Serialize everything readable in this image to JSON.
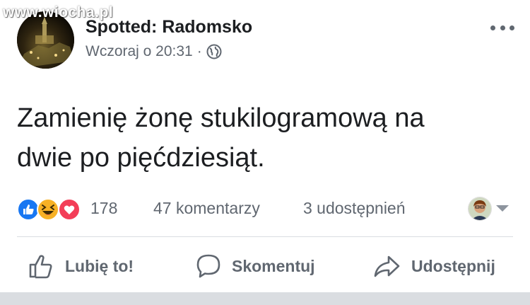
{
  "watermark": {
    "text": "www.wiocha.pl"
  },
  "post": {
    "page_name": "Spotted: Radomsko",
    "timestamp": "Wczoraj o 20:31",
    "separator": "·",
    "privacy_icon": "globe-icon",
    "more_icon": "more-options-icon",
    "text": "Zamienię żonę stukilogramową na\ndwie po pięćdziesiąt."
  },
  "stats": {
    "reactions": [
      "like-reaction-icon",
      "haha-reaction-icon",
      "love-reaction-icon"
    ],
    "reaction_count": "178",
    "comments": "47 komentarzy",
    "shares": "3 udostępnień"
  },
  "actions": {
    "like_label": "Lubię to!",
    "comment_label": "Skomentuj",
    "share_label": "Udostępnij"
  },
  "colors": {
    "like_blue": "#1877f2",
    "haha_yellow": "#f7b125",
    "love_red": "#f33e58",
    "text_secondary": "#606770"
  }
}
